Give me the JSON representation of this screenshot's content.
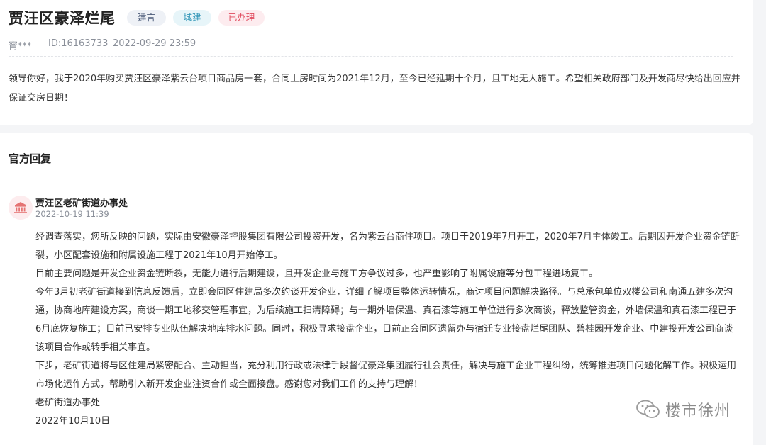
{
  "petition": {
    "title": "贾汪区豪泽烂尾",
    "tags": [
      "建言",
      "城建",
      "已办理"
    ],
    "user": "甯***",
    "id": "ID:16163733",
    "time": "2022-09-29 23:59",
    "content_lines": [
      "领导你好，我于2020年购买贾汪区豪泽紫云台项目商品房一套，合同上房时间为2021年12月，至今已经延期十个月，且工地无人施工。希望相关政府部门及开发商尽快给出回应并",
      "保证交房日期！"
    ]
  },
  "reply": {
    "heading": "官方回复",
    "department": "贾汪区老矿街道办事处",
    "time": "2022-10-19 11:39",
    "avatar_icon": "government-building-icon",
    "lines": [
      "经调查落实，您所反映的问题，实际由安徽豪泽控股集团有限公司投资开发，名为紫云台商住项目。项目于2019年7月开工，2020年7月主体竣工。后期因开发企业资金链断",
      "裂，小区配套设施和附属设施工程于2021年10月开始停工。",
      "目前主要问题是开发企业资金链断裂，无能力进行后期建设，且开发企业与施工方争议过多，也严重影响了附属设施等分包工程进场复工。",
      "今年3月初老矿街道接到信息反馈后，立即会同区住建局多次约谈开发企业，详细了解项目整体运转情况，商讨项目问题解决路径。与总承包单位双楼公司和南通五建多次沟",
      "通，协商地库建设方案，商谈一期工地移交管理事宜，为后续施工扫清障碍；与一期外墙保温、真石漆等施工单位进行多次商谈，释放监管资金，外墙保温和真石漆工程已于",
      "6月底恢复施工；目前已安排专业队伍解决地库排水问题。同时，积极寻求接盘企业，目前正会同区遗留办与宿迁专业接盘烂尾团队、碧桂园开发企业、中建投开发公司商谈",
      "该项目合作或转手相关事宜。",
      "下步，老矿街道将与区住建局紧密配合、主动担当，充分利用行政或法律手段督促豪泽集团履行社会责任，解决与施工企业工程纠纷，统筹推进项目问题化解工作。积极运用",
      "市场化运作方式，帮助引入新开发企业注资合作或全面接盘。感谢您对我们工作的支持与理解！",
      "老矿街道办事处",
      "2022年10月10日"
    ]
  },
  "watermark": {
    "text": "楼市徐州",
    "icon": "wechat-icon"
  },
  "colors": {
    "tag_suggestion": "#4a5a78",
    "tag_urban": "#3497b8",
    "tag_done": "#e04a5d",
    "avatar_icon": "#e57373"
  }
}
